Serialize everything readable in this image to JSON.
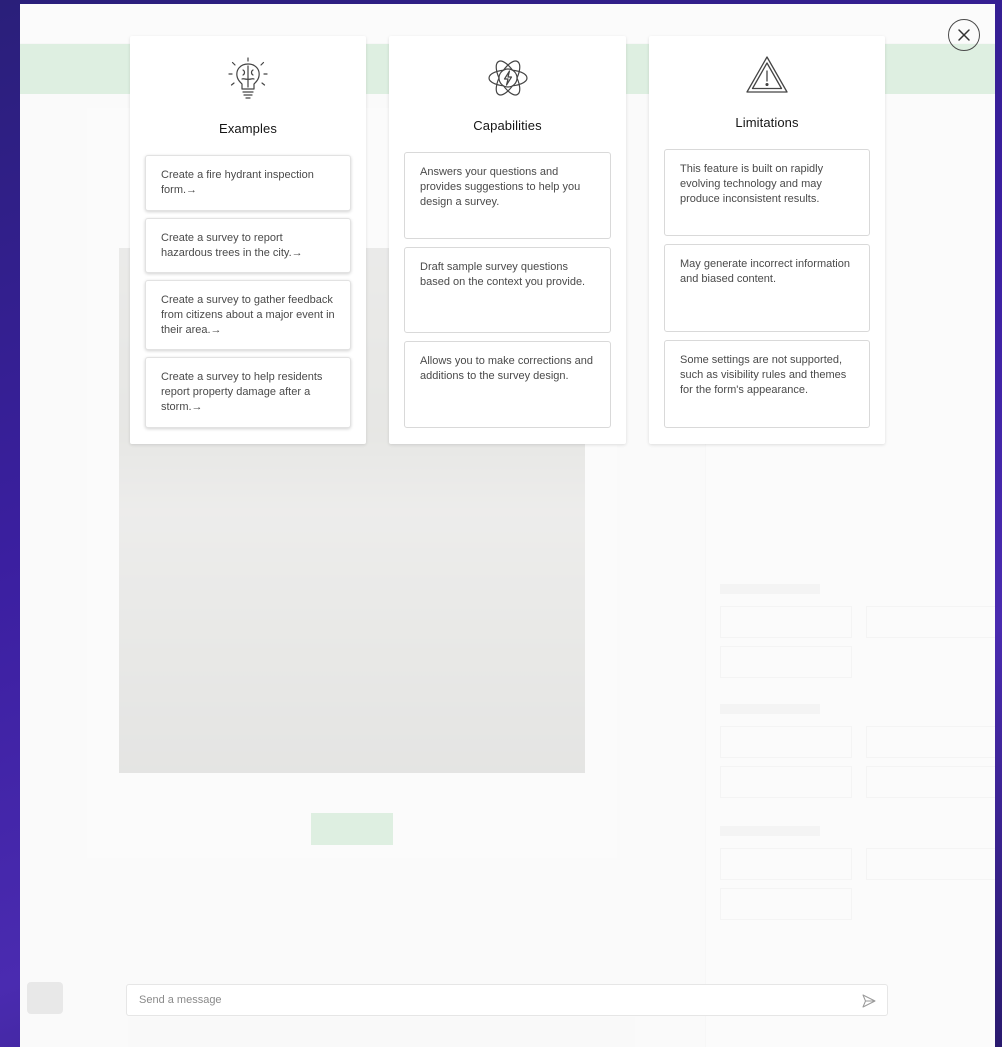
{
  "overlay": {
    "close_label": "Close"
  },
  "panels": [
    {
      "title": "Examples",
      "icon": "lightbulb-brain-icon",
      "items": [
        "Create a fire hydrant inspection form.→",
        "Create a survey to report hazardous trees in the city.→",
        "Create a survey to gather feedback from citizens about a major event in their area.→",
        "Create a survey to help residents report property damage after a storm.→"
      ]
    },
    {
      "title": "Capabilities",
      "icon": "atom-lightning-icon",
      "items": [
        "Answers your questions and provides suggestions to help you design a survey.",
        "Draft sample survey questions based on the context you provide.",
        "Allows you to make corrections and additions to the survey design."
      ]
    },
    {
      "title": "Limitations",
      "icon": "warning-triangle-icon",
      "items": [
        "This feature is built on rapidly evolving technology and may produce inconsistent results.",
        "May generate incorrect information and biased content.",
        "Some settings are not supported, such as visibility rules and themes for the form's appearance."
      ]
    }
  ],
  "chat": {
    "placeholder": "Send a message"
  },
  "colors": {
    "brand_green": "#35ac46",
    "background_purple": "#3b1fa0"
  }
}
